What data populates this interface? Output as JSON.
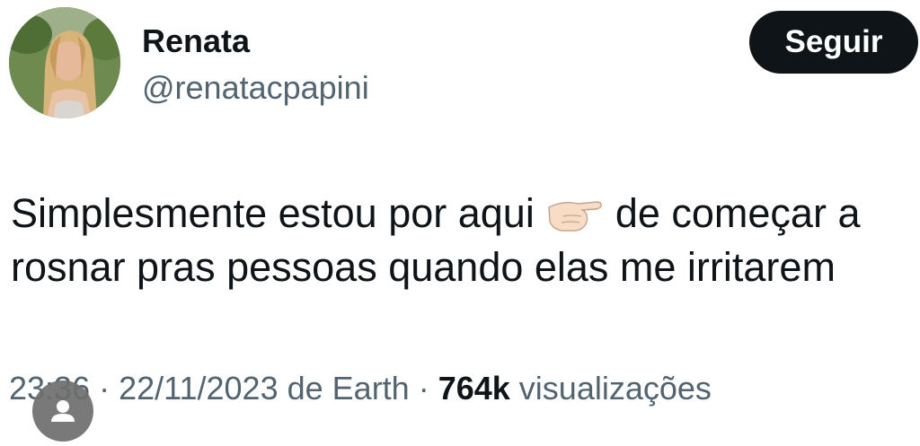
{
  "author": {
    "display_name": "Renata",
    "handle": "@renatacpapini"
  },
  "follow_button": {
    "label": "Seguir"
  },
  "tweet": {
    "text_part1": "Simplesmente estou por aqui",
    "emoji": "pinching-hand-icon",
    "text_part2": "de começar a rosnar pras pessoas quando elas me irritarem"
  },
  "meta": {
    "time": "23:36",
    "separator1": " · ",
    "date": "22/11/2023",
    "source": " de Earth",
    "separator2": " · ",
    "views_count": "764k",
    "views_label": " visualizações"
  },
  "overlay": {
    "icon": "person-icon"
  },
  "colors": {
    "text_primary": "#0f1419",
    "text_secondary": "#536471",
    "button_bg": "#0f1419",
    "button_text": "#ffffff"
  }
}
